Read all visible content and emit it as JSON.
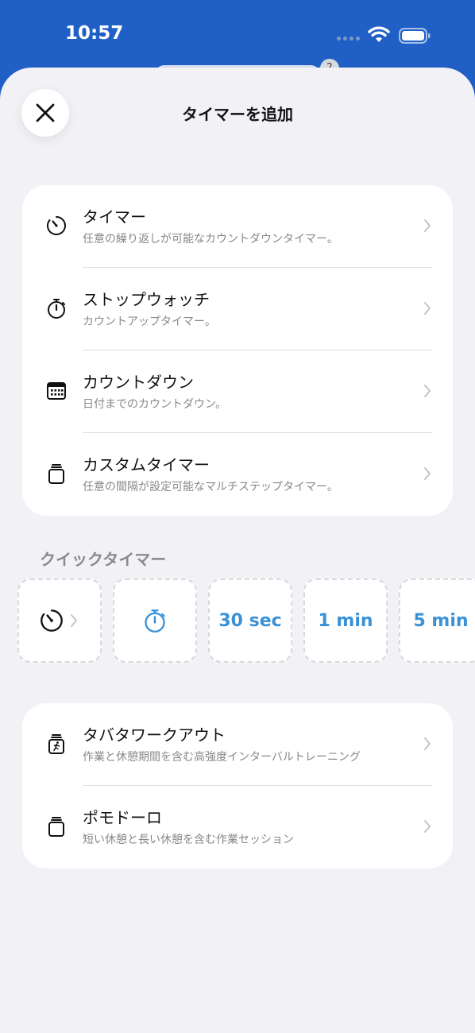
{
  "status": {
    "time": "10:57",
    "badge": "2"
  },
  "sheet": {
    "title": "タイマーを追加"
  },
  "timer_types": [
    {
      "title": "タイマー",
      "subtitle": "任意の繰り返しが可能なカウントダウンタイマー。",
      "icon": "timer-icon"
    },
    {
      "title": "ストップウォッチ",
      "subtitle": "カウントアップタイマー。",
      "icon": "stopwatch-icon"
    },
    {
      "title": "カウントダウン",
      "subtitle": "日付までのカウントダウン。",
      "icon": "calendar-icon"
    },
    {
      "title": "カスタムタイマー",
      "subtitle": "任意の間隔が設定可能なマルチステップタイマー。",
      "icon": "jar-icon"
    }
  ],
  "quick": {
    "label": "クイックタイマー",
    "items": [
      "30 sec",
      "1 min",
      "5 min"
    ]
  },
  "presets": [
    {
      "title": "タバタワークアウト",
      "subtitle": "作業と休憩期間を含む高強度インターバルトレーニング",
      "icon": "workout-jar-icon"
    },
    {
      "title": "ポモドーロ",
      "subtitle": "短い休憩と長い休憩を含む作業セッション",
      "icon": "jar-icon"
    }
  ],
  "colors": {
    "accent": "#3a91d6",
    "header": "#2060c6",
    "background": "#f1f1f6"
  }
}
